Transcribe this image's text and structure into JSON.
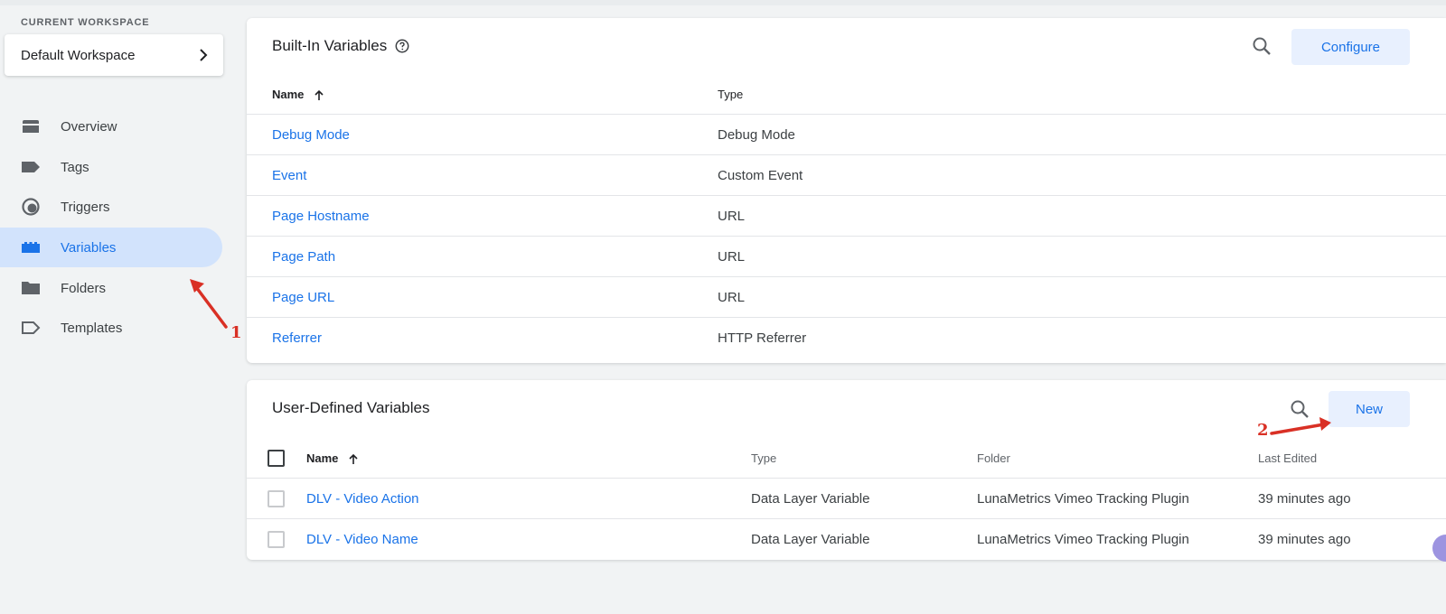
{
  "sidebar": {
    "workspace_label": "CURRENT WORKSPACE",
    "workspace_name": "Default Workspace",
    "items": [
      {
        "label": "Overview",
        "icon": "overview-icon"
      },
      {
        "label": "Tags",
        "icon": "tag-icon"
      },
      {
        "label": "Triggers",
        "icon": "trigger-icon"
      },
      {
        "label": "Variables",
        "icon": "variables-icon",
        "active": true
      },
      {
        "label": "Folders",
        "icon": "folder-icon"
      },
      {
        "label": "Templates",
        "icon": "template-icon"
      }
    ]
  },
  "builtin": {
    "title": "Built-In Variables",
    "configure_label": "Configure",
    "columns": {
      "name": "Name",
      "type": "Type"
    },
    "rows": [
      {
        "name": "Debug Mode",
        "type": "Debug Mode"
      },
      {
        "name": "Event",
        "type": "Custom Event"
      },
      {
        "name": "Page Hostname",
        "type": "URL"
      },
      {
        "name": "Page Path",
        "type": "URL"
      },
      {
        "name": "Page URL",
        "type": "URL"
      },
      {
        "name": "Referrer",
        "type": "HTTP Referrer"
      }
    ]
  },
  "userdefined": {
    "title": "User-Defined Variables",
    "new_label": "New",
    "columns": {
      "name": "Name",
      "type": "Type",
      "folder": "Folder",
      "last_edited": "Last Edited"
    },
    "rows": [
      {
        "name": "DLV - Video Action",
        "type": "Data Layer Variable",
        "folder": "LunaMetrics Vimeo Tracking Plugin",
        "last_edited": "39 minutes ago"
      },
      {
        "name": "DLV - Video Name",
        "type": "Data Layer Variable",
        "folder": "LunaMetrics Vimeo Tracking Plugin",
        "last_edited": "39 minutes ago"
      }
    ]
  },
  "annotations": {
    "first": "1",
    "second": "2",
    "color": "#d93025"
  },
  "colors": {
    "accent": "#1a73e8",
    "active_bg": "#d2e3fc",
    "button_bg": "#e8f0fe"
  }
}
